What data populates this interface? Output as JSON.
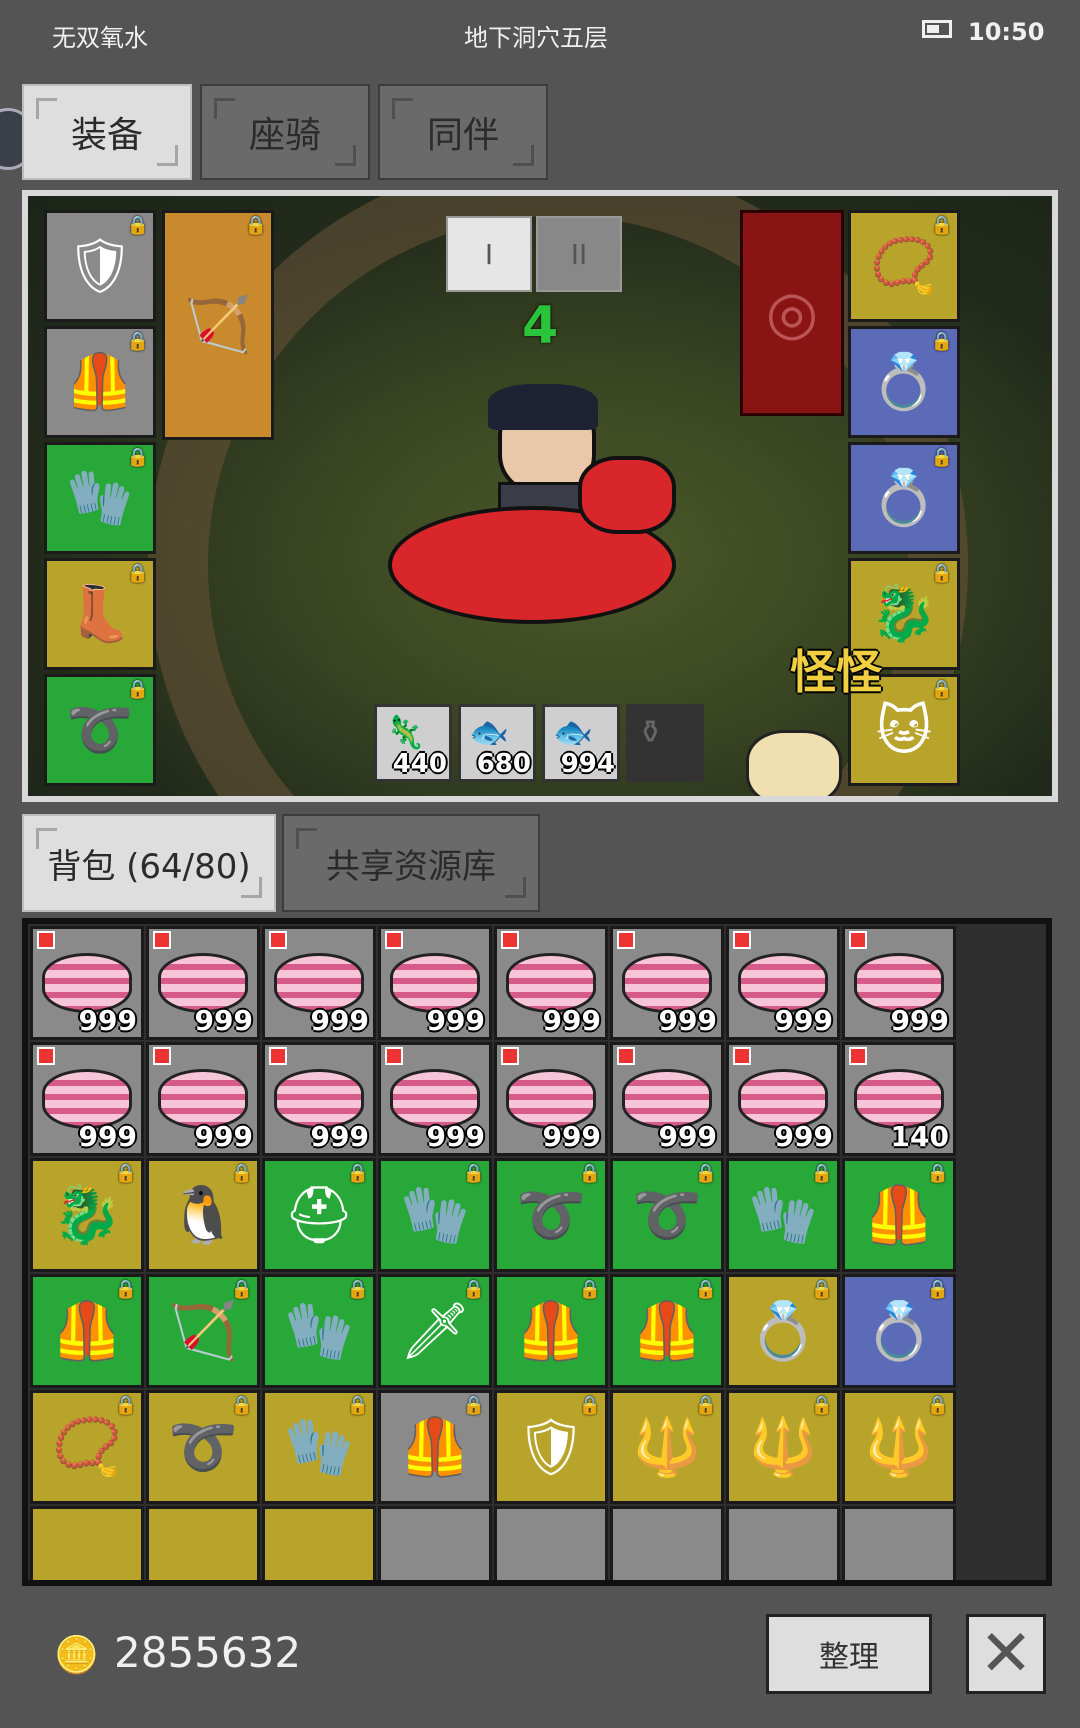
{
  "status_bar": {
    "left_text": "无双氧水",
    "center_text": "地下洞穴五层",
    "time": "10:50",
    "battery_icon": "battery-icon"
  },
  "equip_tabs": [
    {
      "label": "装备",
      "active": true
    },
    {
      "label": "座骑",
      "active": false
    },
    {
      "label": "同伴",
      "active": false
    }
  ],
  "scene": {
    "phase_buttons": [
      "I",
      "II"
    ],
    "level_number": "4",
    "companion_name": "怪怪",
    "resources": [
      {
        "icon": "dragon-scale-icon",
        "value": "440"
      },
      {
        "icon": "fish-icon",
        "value": "680"
      },
      {
        "icon": "fish-icon",
        "value": "994"
      }
    ],
    "left_slots": [
      "armor-icon",
      "armor-icon",
      "gauntlet-icon",
      "boots-icon",
      "belt-icon"
    ],
    "weapon_slot": "bow-icon",
    "right_slots": [
      "necklace-icon",
      "ring-icon",
      "ring-icon",
      "dragon-mount-icon",
      "cat-pet-icon"
    ]
  },
  "bag_tabs": [
    {
      "label": "背包 (64/80)",
      "active": true
    },
    {
      "label": "共享资源库",
      "active": false
    }
  ],
  "inventory": {
    "cake_row1": [
      "999",
      "999",
      "999",
      "999",
      "999",
      "999",
      "999",
      "999"
    ],
    "cake_row2": [
      "999",
      "999",
      "999",
      "999",
      "999",
      "999",
      "999",
      "140"
    ],
    "gear_rows": [
      [
        {
          "icon": "dragon-card-icon",
          "quality": "gold"
        },
        {
          "icon": "penguin-card-icon",
          "quality": "gold"
        },
        {
          "icon": "horned-helmet-icon",
          "quality": "green"
        },
        {
          "icon": "gauntlet-icon",
          "quality": "green"
        },
        {
          "icon": "belt-icon",
          "quality": "green"
        },
        {
          "icon": "belt-icon",
          "quality": "green"
        },
        {
          "icon": "gauntlet-icon",
          "quality": "green"
        },
        {
          "icon": "armor-icon",
          "quality": "green"
        }
      ],
      [
        {
          "icon": "armor-icon",
          "quality": "green"
        },
        {
          "icon": "bow-icon",
          "quality": "green"
        },
        {
          "icon": "glove-icon",
          "quality": "green"
        },
        {
          "icon": "sword-icon",
          "quality": "green"
        },
        {
          "icon": "vest-icon",
          "quality": "green"
        },
        {
          "icon": "vest-icon",
          "quality": "green"
        },
        {
          "icon": "ring-icon",
          "quality": "gold"
        },
        {
          "icon": "ring-icon",
          "quality": "blue"
        }
      ],
      [
        {
          "icon": "amulet-icon",
          "quality": "gold"
        },
        {
          "icon": "belt-icon",
          "quality": "gold"
        },
        {
          "icon": "gauntlet-icon",
          "quality": "gold"
        },
        {
          "icon": "armor-icon",
          "quality": "gray"
        },
        {
          "icon": "shield-icon",
          "quality": "gold"
        },
        {
          "icon": "spear-icon",
          "quality": "gold"
        },
        {
          "icon": "spear-icon",
          "quality": "gold"
        },
        {
          "icon": "trident-icon",
          "quality": "gold"
        }
      ]
    ]
  },
  "footer": {
    "gold_icon": "gold-coins-icon",
    "gold_amount": "2855632",
    "sort_label": "整理",
    "close_icon": "close-icon"
  }
}
